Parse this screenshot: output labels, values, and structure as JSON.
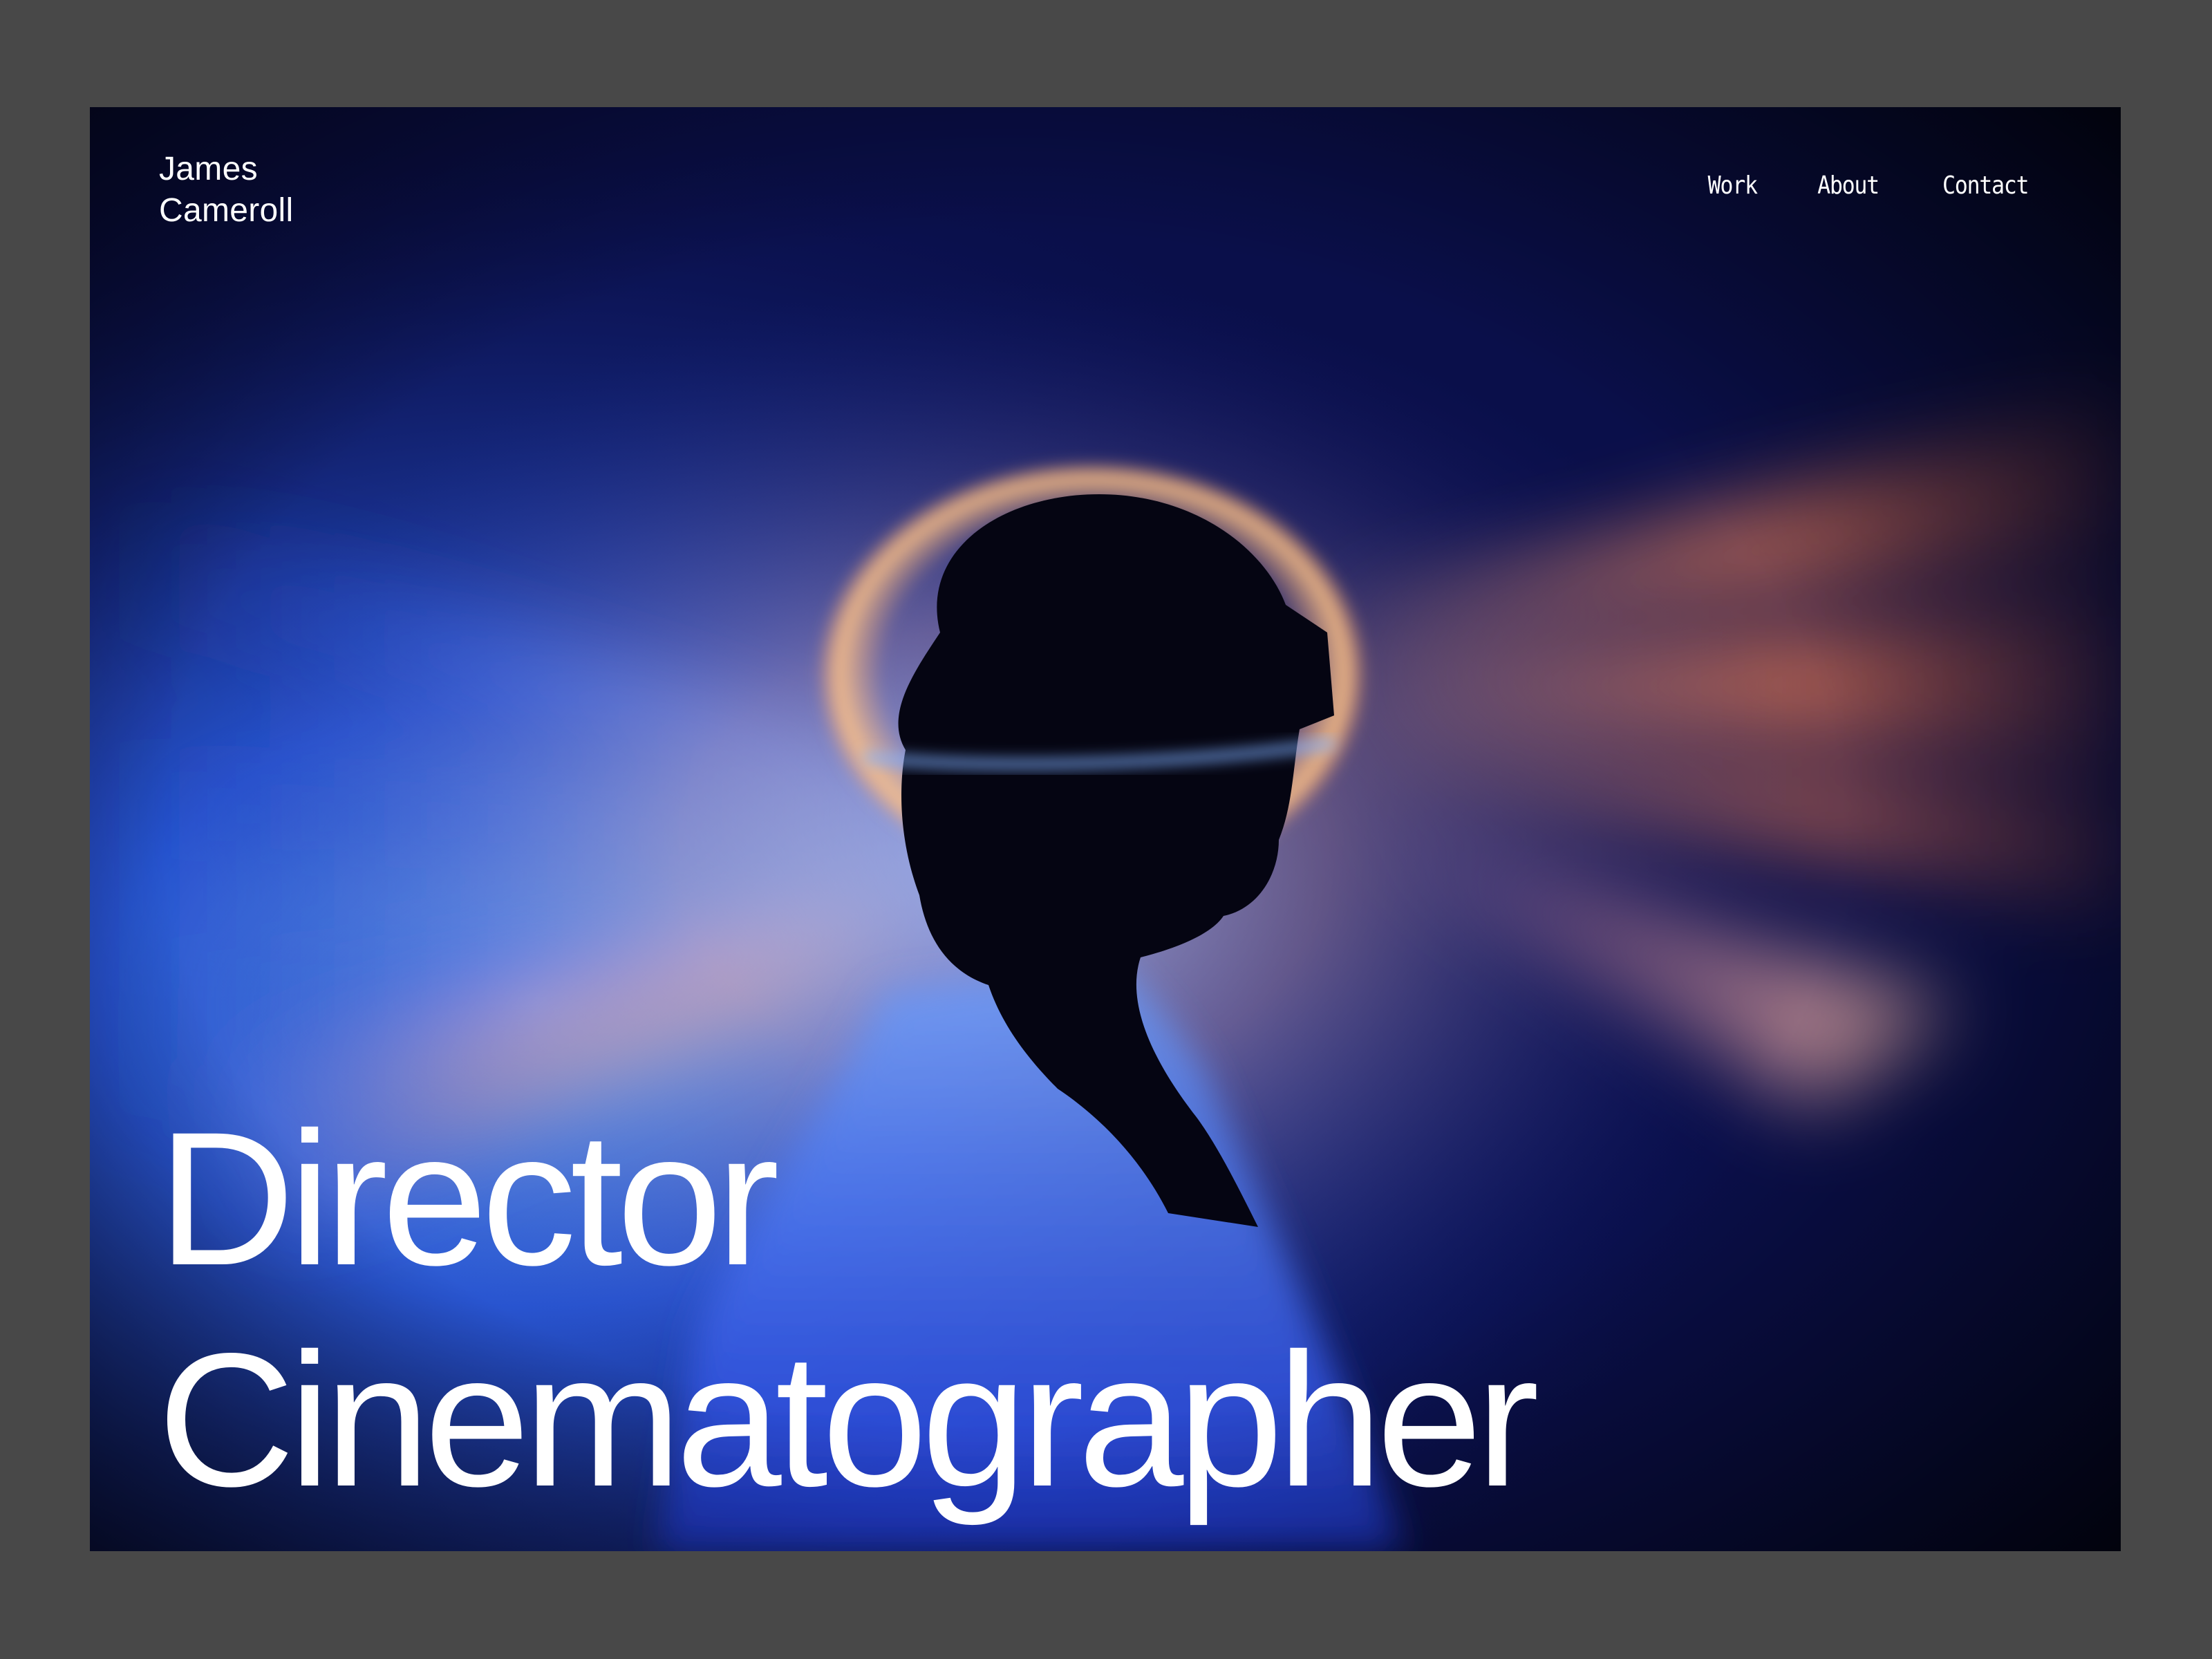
{
  "site": {
    "brand_line1": "James",
    "brand_line2": "Cameroll"
  },
  "nav": {
    "items": [
      {
        "label": "Work"
      },
      {
        "label": "About"
      },
      {
        "label": "Contact"
      }
    ]
  },
  "hero": {
    "headline_line1": "Director",
    "headline_line2": "Cinematographer",
    "image_subject": "silhouette-of-person-with-vr-headset-light-rays"
  },
  "colors": {
    "page_background": "#484848",
    "hero_dark": "#06081c",
    "ray_blue": "#2f5fe0",
    "ray_orange": "#f08a5a",
    "text": "#ffffff"
  }
}
